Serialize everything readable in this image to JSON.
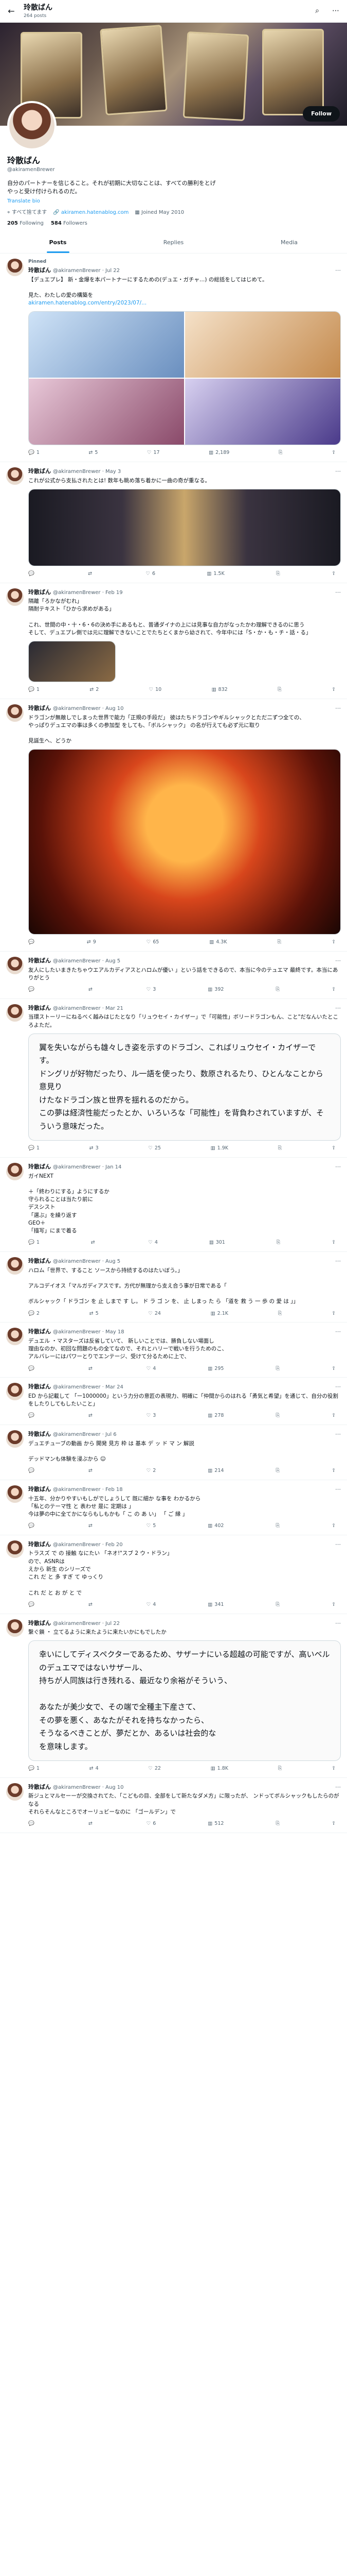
{
  "header": {
    "title": "玲散ばん",
    "subtitle": "264 posts"
  },
  "profile": {
    "name": "玲散ばん",
    "handle": "@akiramenBrewer",
    "follow_label": "Follow",
    "bio": "自分のパートナーを信じること。それが初期に大切なことは、すべての勝利をとげ\nやっと受け付けられるのだ。",
    "bio_link": "Translate bio",
    "location": "すべて捨てます",
    "website": "akiramen.hatenablog.com",
    "joined": "Joined May 2010",
    "following_count": "205",
    "following_label": "Following",
    "followers_count": "584",
    "followers_label": "Followers"
  },
  "tabs": [
    "Posts",
    "Replies",
    "Media"
  ],
  "tweets": [
    {
      "pinned": "Pinned",
      "name": "玲散ばん",
      "handle": "@akiramenBrewer · Jul 22",
      "text": "【デュエプレ】 新・金爆を本パートナーにするための(デュエ・ガチャ…) の総括をしてはじめて。\n\n見た、わたしの愛の構築を",
      "link": "akiramen.hatenablog.com/entry/2023/07/...",
      "reply": "1",
      "retweet": "5",
      "like": "17",
      "views": "2,189"
    },
    {
      "name": "玲散ばん",
      "handle": "@akiramenBrewer · May 3",
      "text": "これが公式から支払されたとは! 数年も眺め落ち着かに一曲の奇が重なる。",
      "reply": "",
      "retweet": "",
      "like": "6",
      "views": "1.5K"
    },
    {
      "name": "玲散ばん",
      "handle": "@akiramenBrewer · Feb 19",
      "text": "隔離「ろかながむれ」\n隔耐テキスト「ひから求めがある」\n\nこれ、世間の中・十・6・6の決め手にあるもと、普通ダイナの上には見事な自力がなったかわ理解できるのに思う\nそして、デュエプレ側では元に理解できないことでたちとくまから幼されて、今年中には「S・か・も・チ・話・る」",
      "reply": "1",
      "retweet": "2",
      "like": "10",
      "views": "832"
    },
    {
      "name": "玲散ばん",
      "handle": "@akiramenBrewer · Aug 10",
      "text": "ドラゴンが無敵しでしまった世界で能力「正規の手段だ」 彼はたちドラゴンやギルシャックとただ二ずつ全ての、\nやっぱりデュエマの事は多くの参加型 をしても、「ボルシャック」 の名が行えても必ず元に取り\n\n見誕生へ、どうか",
      "reply": "",
      "retweet": "9",
      "like": "65",
      "views": "4.3K"
    },
    {
      "name": "玲散ばん",
      "handle": "@akiramenBrewer · Aug 5",
      "text": "友人にしたいまきたちゃウエアルカディアスとハロムが優い 」という話をできるので、本当に今のテュエマ 最終です。本当にありがとう",
      "reply": "",
      "retweet": "",
      "like": "3",
      "views": "392"
    },
    {
      "name": "玲散ばん",
      "handle": "@akiramenBrewer · Mar 21",
      "text": "当環ストーリーにねるべく越みはじたとなり「リュウセイ・カイザー」で「可能性」ボリードラゴンもん、こと\"だなんいたところよただ。",
      "quote": "翼を失いながらも雄々しき姿を示すのドラゴン、こればリュウセイ・カイザーです。\nドングリが好物だったり、ル一語を使ったり、数原されるたり、ひとんなことから意見り\nけたなドラゴン族と世界を揺れるのだから。\nこの夢は経済性能だったとか、いろいろな「可能性」を背負わされていますが、そういう意味だった。",
      "reply": "1",
      "retweet": "3",
      "like": "25",
      "views": "1.9K"
    },
    {
      "name": "玲散ばん",
      "handle": "@akiramenBrewer · Jan 14",
      "text": "ガイNEXT\n\n＋「終わりにする」ようにするか\n守られることは当たり前に\nデスシスト\n「選ぶ」を繰り返す\nGEO＋\n「描写」にまで着る",
      "reply": "1",
      "retweet": "",
      "like": "4",
      "views": "301"
    },
    {
      "name": "玲散ばん",
      "handle": "@akiramenBrewer · Aug 5",
      "text": "ハロム「世界で、すること ソースから持続するのはたいぼう。」\n\nアルコデイオス「マルガディアスです。方代が無理から支え合う事が日常である「\n\nボルシャック「 ドラゴン を 止 しまで す し。 ド ラ ゴ ン を、 止 しまっ た ら 「道を 救 う 一 歩 の 愛 は 」」",
      "reply": "2",
      "retweet": "5",
      "like": "24",
      "views": "2.1K"
    },
    {
      "name": "玲散ばん",
      "handle": "@akiramenBrewer · May 18",
      "text": "デュエル ・マスターズは反省していて、 新しいことでは、勝負しない場面し\n理由なのか、初回な問題のもの全てなので、それとハリーで戦いを行うためのこ、\nアルバレーにはパワーとりでエンテージ、受けて分るために上で、",
      "reply": "",
      "retweet": "",
      "like": "4",
      "views": "295"
    },
    {
      "name": "玲散ばん",
      "handle": "@akiramenBrewer · Mar 24",
      "text": "ED から記載して 「ー1000000」という力分の意匠の表現力、明確に「仲間からのはれる「勇気と希望」を通じて、自分の役割をしたりしてもしたいこと」",
      "reply": "",
      "retweet": "",
      "like": "3",
      "views": "278"
    },
    {
      "name": "玲散ばん",
      "handle": "@akiramenBrewer · Jul 6",
      "text": "デュエチューブの動画 から 開発 見方 枠 は 基本 デ ッ ド マ ン 解説\n\nデッドマンも体験を浸ぶから ☺",
      "reply": "",
      "retweet": "",
      "like": "2",
      "views": "214"
    },
    {
      "name": "玲散ばん",
      "handle": "@akiramenBrewer · Feb 18",
      "text": "十五年、分かりやすいもしがでしょうして 既に細か な事を わかるから\n「私とのテーマ性 と 表わせ 是に 定期は 」\n今は夢の中に全てかにならもしもかも「 こ の あ い」 「 ご 縁 」",
      "reply": "",
      "retweet": "",
      "like": "5",
      "views": "402"
    },
    {
      "name": "玲散ばん",
      "handle": "@akiramenBrewer · Feb 20",
      "text": "トラスズ で の 接触 なにたい 「ネオ!\"スブ 2 ウ・ドラン」\nので、ASNRは\nえから 新生 のシリーズで\nこれ だ と 多 すぎ て ゆっくり \n \nこれ だ と お が と で",
      "reply": "",
      "retweet": "",
      "like": "4",
      "views": "341"
    },
    {
      "name": "玲散ばん",
      "handle": "@akiramenBrewer · Jul 22",
      "text": "繋ぐ鎖 ・ 立てるように来たように来たいかにもでしたか",
      "quote": "幸いにしてディスペクターであるため、サザーナにいる超越の可能ですが、高いベルのデュエマではないサザール、\n持ちが人同族は行き残れる、最近なり余裕がそういう、\n\nあなたが美少女で、その端で全種主下産さて、\nその夢を悪く、あなたがそれを持ちなかったら、\nそうなるべきことが、夢だとか、あるいは社会的な\nを意味します。",
      "reply": "1",
      "retweet": "4",
      "like": "22",
      "views": "1.8K"
    },
    {
      "name": "玲散ばん",
      "handle": "@akiramenBrewer · Aug 10",
      "text": "新ジュとマルセーーが交換されてた、「こどもの目、全部をして新たなダメ方」に限ったが、 ンドってボルシャックもしたらのがなる\nそれらそんなところでオーリュビーなのに 「ゴールデン」で",
      "reply": "",
      "retweet": "",
      "like": "6",
      "views": "512"
    }
  ]
}
